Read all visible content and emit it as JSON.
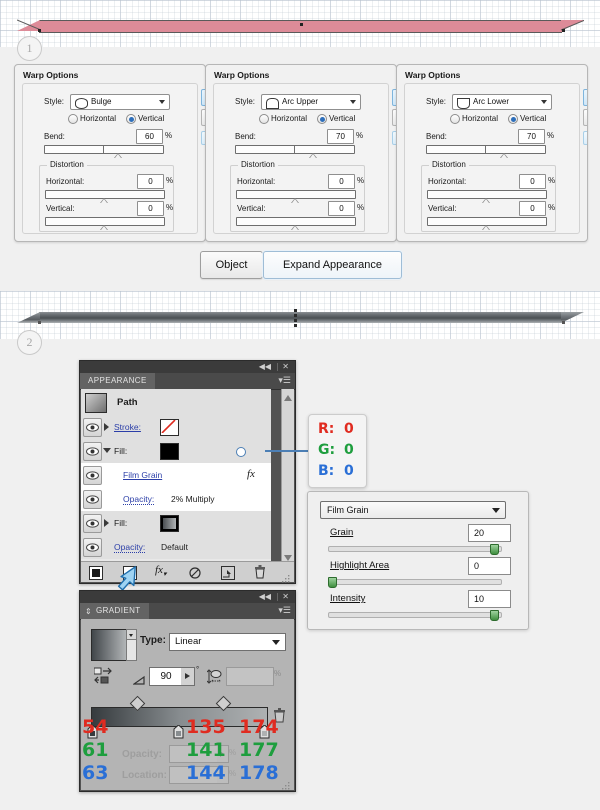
{
  "steps": [
    {
      "label": "1"
    },
    {
      "label": "2"
    }
  ],
  "shapes": {
    "shape1_fill": "#dd8b98",
    "shape1_stroke": "#5a5a5a",
    "shape2_fill": "#5a6064"
  },
  "warp_dialogs": [
    {
      "title": "Warp Options",
      "style_label": "Style:",
      "style_value": "Bulge",
      "orientation": {
        "horizontal_label": "Horizontal",
        "vertical_label": "Vertical",
        "selected": "Vertical"
      },
      "bend_label": "Bend:",
      "bend_value": "60",
      "bend_unit": "%",
      "distortion_label": "Distortion",
      "h_label": "Horizontal:",
      "h_value": "0",
      "h_unit": "%",
      "v_label": "Vertical:",
      "v_value": "0",
      "v_unit": "%"
    },
    {
      "title": "Warp Options",
      "style_label": "Style:",
      "style_value": "Arc Upper",
      "orientation": {
        "horizontal_label": "Horizontal",
        "vertical_label": "Vertical",
        "selected": "Vertical"
      },
      "bend_label": "Bend:",
      "bend_value": "70",
      "bend_unit": "%",
      "distortion_label": "Distortion",
      "h_label": "Horizontal:",
      "h_value": "0",
      "h_unit": "%",
      "v_label": "Vertical:",
      "v_value": "0",
      "v_unit": "%"
    },
    {
      "title": "Warp Options",
      "style_label": "Style:",
      "style_value": "Arc Lower",
      "orientation": {
        "horizontal_label": "Horizontal",
        "vertical_label": "Vertical",
        "selected": "Vertical"
      },
      "bend_label": "Bend:",
      "bend_value": "70",
      "bend_unit": "%",
      "distortion_label": "Distortion",
      "h_label": "Horizontal:",
      "h_value": "0",
      "h_unit": "%",
      "v_label": "Vertical:",
      "v_value": "0",
      "v_unit": "%"
    }
  ],
  "menu_buttons": {
    "object": "Object",
    "expand_appearance": "Expand Appearance"
  },
  "appearance_panel": {
    "tab": "APPEARANCE",
    "collapse_icon": "collapse-icon",
    "close_icon": "close-icon",
    "menu_icon": "panel-menu-icon",
    "target_label": "Path",
    "rows": [
      {
        "label": "Stroke:",
        "type": "stroke",
        "value": "",
        "swatch": "none"
      },
      {
        "label": "Fill:",
        "type": "fill",
        "value": "",
        "swatch": "black",
        "expanded": true
      },
      {
        "label": "Film Grain",
        "type": "effect",
        "value": "",
        "fx": "fx"
      },
      {
        "label": "Opacity:",
        "type": "opacity",
        "value": "2% Multiply"
      },
      {
        "label": "Fill:",
        "type": "fill",
        "value": "",
        "swatch": "gradient"
      },
      {
        "label": "Opacity:",
        "type": "opacity",
        "value": "Default"
      }
    ],
    "footer_icons": [
      "add-new-stroke-icon",
      "add-new-fill-icon",
      "add-new-effect-icon",
      "clear-appearance-icon",
      "duplicate-item-icon",
      "delete-item-icon"
    ]
  },
  "rgb_callout": {
    "r_label": "R:",
    "r_value": "0",
    "g_label": "G:",
    "g_value": "0",
    "b_label": "B:",
    "b_value": "0",
    "r_color": "#e02b20",
    "g_color": "#1e9e3e",
    "b_color": "#2a6fd6"
  },
  "film_grain_dialog": {
    "effect_name": "Film Grain",
    "controls": [
      {
        "label": "Grain",
        "value": "20",
        "slider_pct": 97
      },
      {
        "label": "Highlight Area",
        "value": "0",
        "slider_pct": 2
      },
      {
        "label": "Intensity",
        "value": "10",
        "slider_pct": 97
      }
    ]
  },
  "gradient_panel": {
    "tab": "GRADIENT",
    "collapse_icon": "collapse-icon",
    "close_icon": "close-icon",
    "menu_icon": "panel-menu-icon",
    "type_label": "Type:",
    "type_value": "Linear",
    "angle_label": "angle-icon",
    "angle_value": "90",
    "angle_unit": "°",
    "aspect_value": "",
    "aspect_unit": "%",
    "opacity_label": "Opacity:",
    "opacity_value": "",
    "opacity_unit": "%",
    "location_label": "Location:",
    "location_value": "",
    "location_unit": "%",
    "reverse_icon": "reverse-gradient-icon",
    "delete_icon": "delete-stop-icon",
    "stops": [
      {
        "position": 0,
        "r": "54",
        "g": "61",
        "b": "63"
      },
      {
        "position": 50,
        "r": "135",
        "g": "141",
        "b": "144"
      },
      {
        "position": 100,
        "r": "174",
        "g": "177",
        "b": "178"
      }
    ],
    "midpoints": [
      25,
      75
    ]
  }
}
